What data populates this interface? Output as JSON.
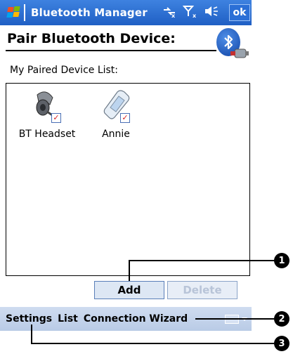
{
  "titlebar": {
    "app_title": "Bluetooth Manager",
    "ok_label": "ok",
    "status_icons": [
      "connectivity-icon",
      "signal-icon",
      "volume-icon"
    ]
  },
  "header": {
    "page_title": "Pair Bluetooth Device:",
    "section_label": "My Paired Device List:"
  },
  "devices": [
    {
      "name": "BT Headset",
      "icon": "headset-icon",
      "checked": true
    },
    {
      "name": "Annie",
      "icon": "pda-icon",
      "checked": true
    }
  ],
  "buttons": {
    "add_label": "Add",
    "delete_label": "Delete"
  },
  "menubar": {
    "items": [
      "Settings",
      "List",
      "Connection Wizard"
    ]
  },
  "callouts": [
    "1",
    "2",
    "3"
  ],
  "colors": {
    "titlebar": "#2b6fd6",
    "menubar": "#c3d3ec",
    "check_mark": "#d82020"
  }
}
